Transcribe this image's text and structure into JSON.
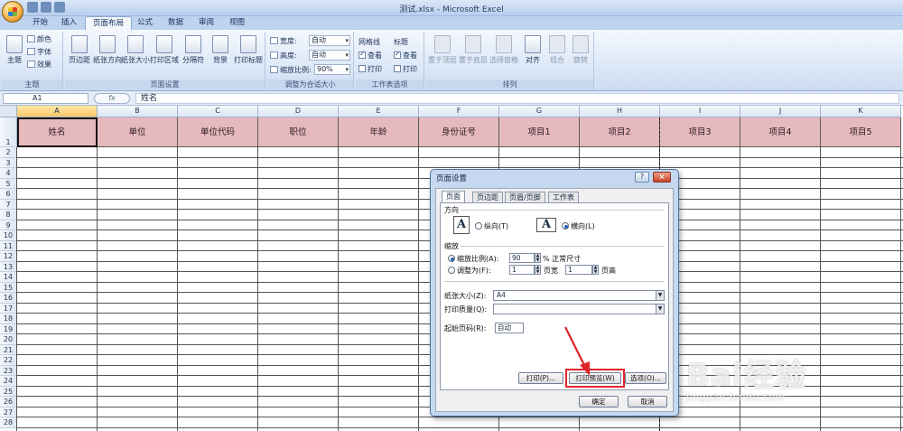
{
  "window": {
    "title": "测试.xlsx - Microsoft Excel"
  },
  "ribbon_tabs": [
    "开始",
    "插入",
    "页面布局",
    "公式",
    "数据",
    "审阅",
    "视图"
  ],
  "ribbon": {
    "theme_group": {
      "label": "主题",
      "theme_btn": "主题",
      "colors": "颜色",
      "fonts": "字体",
      "effects": "效果"
    },
    "page_setup_group": {
      "label": "页面设置",
      "margins": "页边距",
      "orientation": "纸张方向",
      "size": "纸张大小",
      "print_area": "打印区域",
      "breaks": "分隔符",
      "background": "背景",
      "print_titles": "打印标题"
    },
    "scale_group": {
      "label": "调整为合适大小",
      "width_label": "宽度:",
      "width_value": "自动",
      "height_label": "高度:",
      "height_value": "自动",
      "scale_label": "缩放比例:",
      "scale_value": "90%"
    },
    "sheet_options_group": {
      "label": "工作表选项",
      "gridlines": "网格线",
      "headings": "标题",
      "view": "查看",
      "print": "打印"
    },
    "arrange_group": {
      "label": "排列",
      "bring_front": "置于顶层",
      "send_back": "置于底层",
      "selection_pane": "选择窗格",
      "align": "对齐",
      "group": "组合",
      "rotate": "旋转"
    }
  },
  "formula_bar": {
    "cell_ref": "A1",
    "fx": "fx",
    "content": "姓名"
  },
  "sheet": {
    "columns": [
      "A",
      "B",
      "C",
      "D",
      "E",
      "F",
      "G",
      "H",
      "I",
      "J",
      "K"
    ],
    "header_row": [
      "姓名",
      "单位",
      "单位代码",
      "职位",
      "年龄",
      "身份证号",
      "项目1",
      "项目2",
      "项目3",
      "项目4",
      "项目5"
    ],
    "row_numbers": [
      "1",
      "2",
      "3",
      "4",
      "5",
      "6",
      "7",
      "8",
      "9",
      "10",
      "11",
      "12",
      "13",
      "14",
      "15",
      "16",
      "17",
      "18",
      "19",
      "20",
      "21",
      "22",
      "23",
      "24",
      "25",
      "26",
      "27",
      "28"
    ]
  },
  "dialog": {
    "title": "页面设置",
    "help": "?",
    "close": "×",
    "tabs": [
      "页面",
      "页边距",
      "页眉/页脚",
      "工作表"
    ],
    "orientation_label": "方向",
    "portrait": "纵向(T)",
    "landscape": "横向(L)",
    "scaling_label": "缩放",
    "scale_option": "缩放比例(A):",
    "scale_value": "90",
    "scale_suffix": "% 正常尺寸",
    "fit_option": "调整为(F):",
    "fit_wide_value": "1",
    "fit_wide_label": "页宽",
    "fit_tall_value": "1",
    "fit_tall_label": "页高",
    "paper_size_label": "纸张大小(Z):",
    "paper_size_value": "A4",
    "print_quality_label": "打印质量(Q):",
    "print_quality_value": "",
    "first_page_label": "起始页码(R):",
    "first_page_value": "自动",
    "print_btn": "打印(P)...",
    "preview_btn": "打印预览(W)",
    "options_btn": "选项(O)...",
    "ok_btn": "确定",
    "cancel_btn": "取消"
  },
  "watermark": {
    "brand": "Bai经验",
    "url": "jingyan.baidu.com"
  },
  "colors": {
    "header_fill": "#e6b9bd",
    "highlight": "#e0252a",
    "ribbon_bg": "#dde8f7"
  }
}
